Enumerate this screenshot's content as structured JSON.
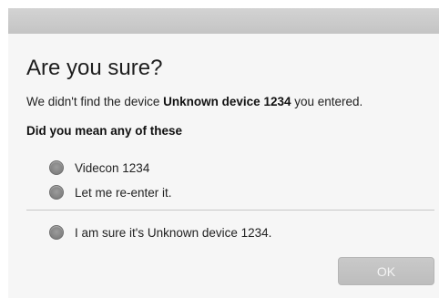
{
  "dialog": {
    "title": "Are you sure?",
    "message": {
      "before": "We didn't find the device ",
      "device_name": "Unknown device 1234",
      "after": " you entered."
    },
    "prompt": "Did you mean any of these",
    "options": [
      {
        "label": "Videcon 1234",
        "icon": "radio-button"
      },
      {
        "label": "Let me re-enter it.",
        "icon": "radio-button"
      }
    ],
    "confirm_option": {
      "label": "I am sure it's Unknown device 1234.",
      "icon": "radio-button"
    },
    "ok_label": "OK"
  },
  "colors": {
    "title_bar": "#c9c9c9",
    "dialog_background": "#f6f6f6",
    "radio": "#8a8a8a",
    "button": "#c3c3c3",
    "button_text": "#f4f4f4"
  }
}
